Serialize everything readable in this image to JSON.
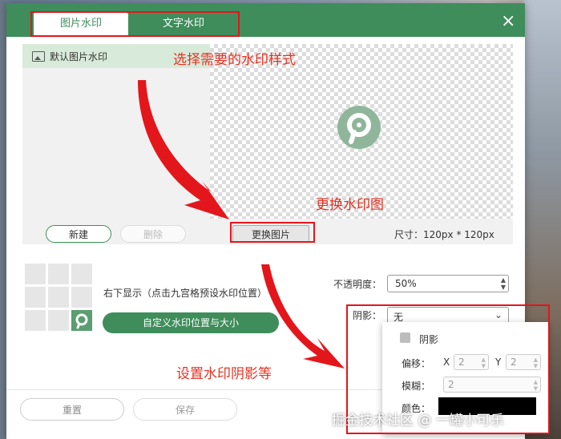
{
  "tabs": {
    "image_label": "图片水印",
    "text_label": "文字水印"
  },
  "close_icon": "close-icon",
  "preview": {
    "default_item_label": "默认图片水印",
    "new_button": "新建",
    "delete_button": "删除",
    "change_button": "更换图片",
    "size_label": "尺寸：120px * 120px"
  },
  "position": {
    "text": "右下显示（点击九宫格预设水印位置）",
    "custom_button": "自定义水印位置与大小",
    "selected_cell": 8
  },
  "opacity": {
    "label": "不透明度：",
    "value": "50%"
  },
  "shadow": {
    "label": "阴影：",
    "value": "无",
    "checkbox_label": "阴影",
    "offset_label": "偏移：",
    "x_label": "X",
    "x_value": "2",
    "y_label": "Y",
    "y_value": "2",
    "blur_label": "模糊：",
    "blur_value": "2",
    "color_label": "颜色：",
    "color_value": "#000000"
  },
  "footer": {
    "reset_button": "重置",
    "save_button": "保存"
  },
  "annotations": {
    "select_style": "选择需要的水印样式",
    "change_image": "更换水印图",
    "set_shadow": "设置水印阴影等"
  },
  "site_watermark": "掘金技术社区 @ 一罐小可乐",
  "colors": {
    "brand": "#3e8d5b",
    "annotation": "#e53223"
  }
}
